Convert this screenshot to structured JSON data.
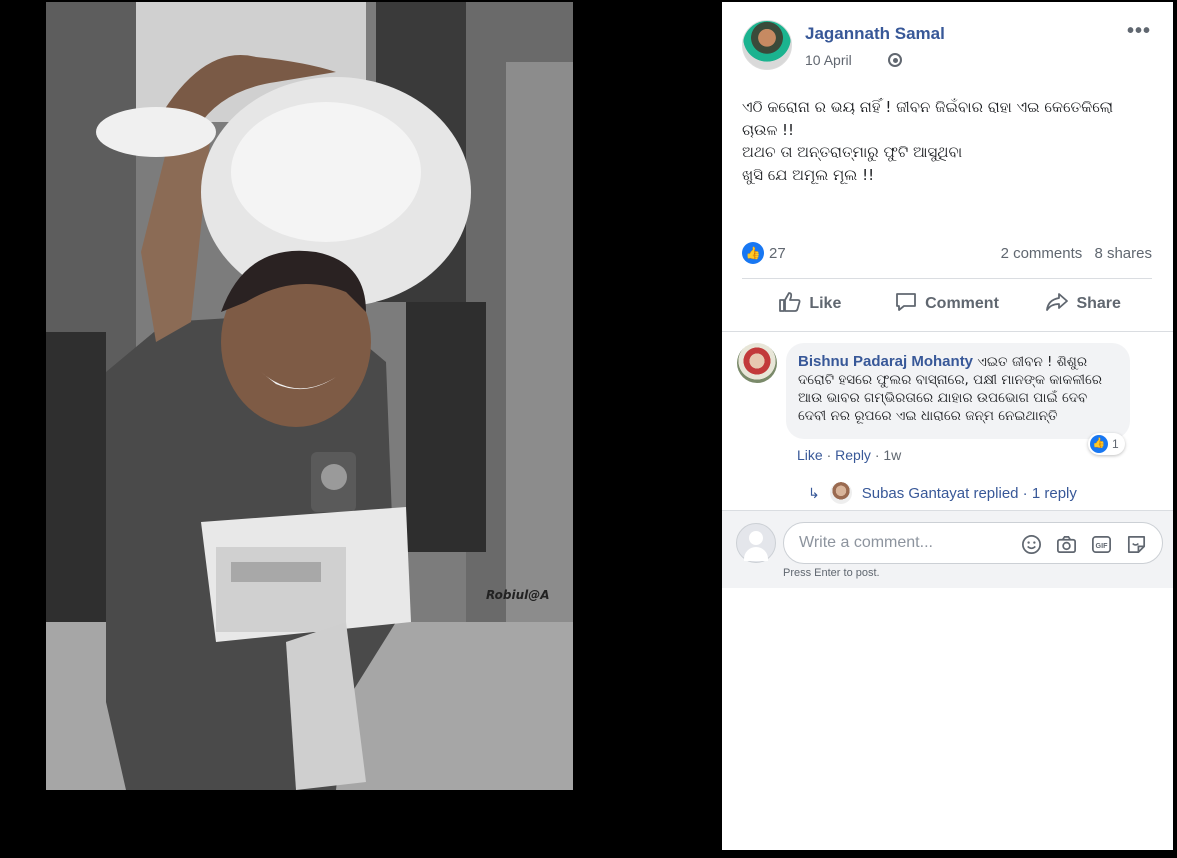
{
  "photo": {
    "watermark": "Robiul@A"
  },
  "post": {
    "author": "Jagannath Samal",
    "date": "10 April",
    "more": "•••",
    "text_lines": [
      "ଏଠି କରୋନା ର ଭୟ ନାହିଁ ! ଜୀବନ ଜିଇଁବାର ରାହା ଏଇ କେତେକିଲୋ",
      "ଚାଉଳ !!",
      "ଅଥଚ ତା ଅନ୍ତରାତ୍ମାରୁ ଫୁଟି ଆସୁଥିବା",
      "ଖୁସି ଯେ ଅମୂଲ ମୂଲ !!"
    ],
    "likes": "27",
    "comments": "2 comments",
    "shares": "8 shares"
  },
  "actions": {
    "like": "Like",
    "comment": "Comment",
    "share": "Share"
  },
  "comment": {
    "author": "Bishnu Padaraj Mohanty",
    "text": "ଏଇତ ଜୀବନ ! ଶିଶୁର ଦରୋଟି ହସରେ ଫୁଲର ବାସ୍ନାରେ, ପକ୍ଷୀ ମାନଙ୍କ କାକଳୀରେ ଆଉ ଭାବର ଗମ୍ଭିରତାରେ ଯାହାର ଉପଭୋଗ ପାଇଁ ଦେବ ଦେବୀ ନର ରୂପରେ ଏଇ ଧାରାରେ ଜନ୍ମ ନେଇଥାନ୍ତି",
    "reaction_count": "1",
    "like_label": "Like",
    "reply_label": "Reply",
    "age": "1w",
    "reply_summary": "Subas Gantayat replied",
    "reply_count": "1 reply"
  },
  "composer": {
    "placeholder": "Write a comment...",
    "hint": "Press Enter to post."
  },
  "colors": {
    "link": "#385898",
    "like_blue": "#1877f2",
    "muted": "#606770"
  }
}
